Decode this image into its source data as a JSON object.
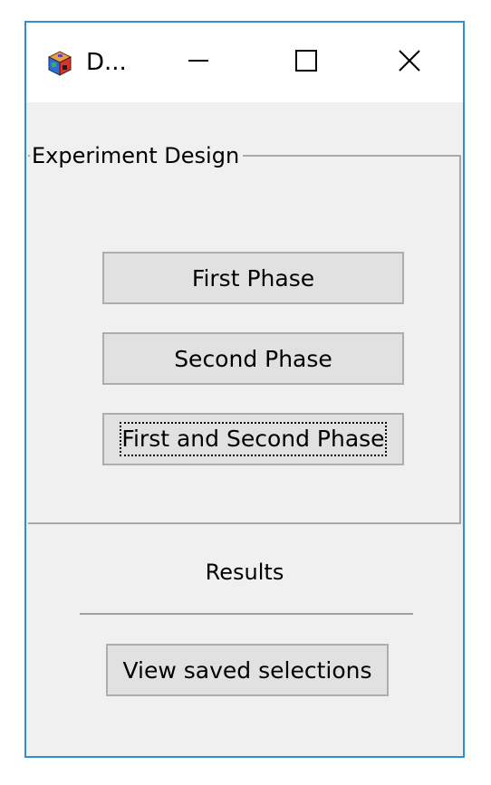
{
  "window": {
    "title": "D...",
    "icon": "app-cube-icon",
    "controls": {
      "minimize_icon": "minimize-icon",
      "maximize_icon": "maximize-icon",
      "close_icon": "close-icon"
    },
    "accent_color": "#2f8fd6"
  },
  "experiment_design": {
    "legend": "Experiment Design",
    "buttons": [
      {
        "label": "First Phase"
      },
      {
        "label": "Second Phase"
      },
      {
        "label": "First and Second Phase",
        "focused": true
      }
    ]
  },
  "results": {
    "label": "Results",
    "view_button_label": "View saved selections"
  }
}
